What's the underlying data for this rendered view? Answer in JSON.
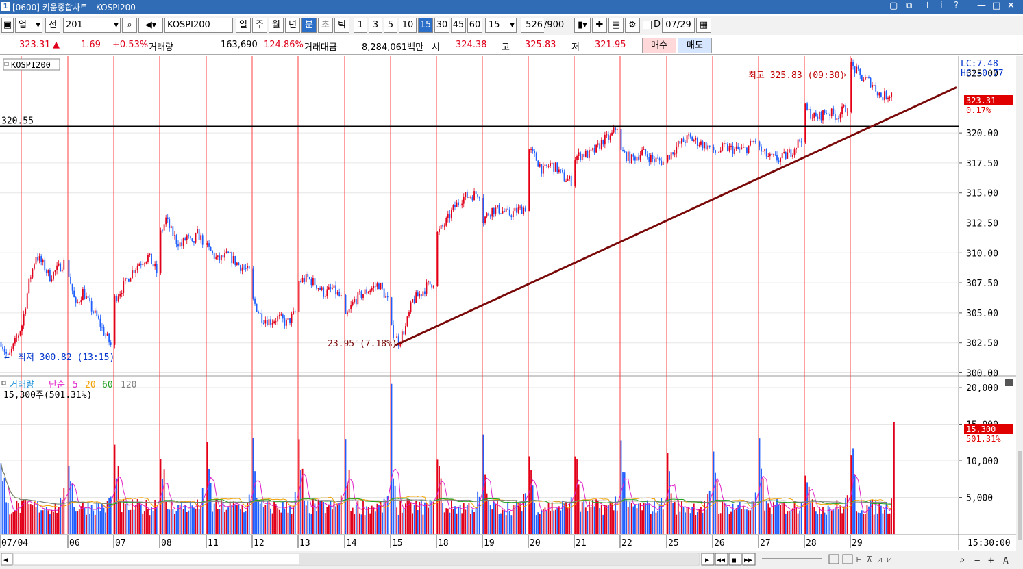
{
  "window": {
    "title": "[0600] 키움종합차트 - KOSPI200",
    "icon_label": "1"
  },
  "toolbar": {
    "market": "업",
    "prev": "전",
    "code": "201",
    "symbol": "KOSPI200",
    "periods": [
      "일",
      "주",
      "월",
      "년",
      "분",
      "초",
      "틱"
    ],
    "selected_period": "분",
    "intervals": [
      "1",
      "3",
      "5",
      "10",
      "15",
      "30",
      "45",
      "60"
    ],
    "selected_interval": "15",
    "interval_value": "15",
    "count": "526",
    "count_total": "/900",
    "date_checkbox_label": "D",
    "date": "07/29"
  },
  "quote": {
    "price": "323.31",
    "direction": "▲",
    "change": "1.69",
    "change_pct": "+0.53%",
    "volume_label": "거래량",
    "volume": "163,690",
    "volume_pct": "124.86%",
    "value_label": "거래대금",
    "value": "8,284,061백만",
    "open_label": "시",
    "open": "324.38",
    "high_label": "고",
    "high": "325.83",
    "low_label": "저",
    "low": "321.95",
    "buy_label": "매수",
    "sell_label": "매도"
  },
  "price_panel": {
    "legend": "KOSPI200",
    "hline_label": "320.55",
    "high_annotation": "최고 325.83 (09:30)",
    "low_annotation": "최저 300.82 (13:15)",
    "trend_annotation": "23.95°(7.18%)",
    "lc": "LC:7.48",
    "hc": "HC:-0.77",
    "current_price_tag": "323.31",
    "current_pct_tag": "0.17%"
  },
  "volume_panel": {
    "legend_title": "거래량",
    "legend_type": "단순",
    "legend_periods": [
      "5",
      "20",
      "60",
      "120"
    ],
    "current_value": "15,300주(501.31%)",
    "tag_value": "15,300",
    "tag_pct": "501.31%"
  },
  "colors": {
    "up": "#e0001b",
    "down": "#1f5fff",
    "trendline": "#7a0a0a",
    "ma5": "#e020c8",
    "ma20": "#f0a000",
    "ma60": "#20a020",
    "ma120": "#808080",
    "divider": "#ff4040"
  },
  "chart_data": {
    "type": "candlestick",
    "x_axis_labels": [
      "07/04",
      "06",
      "07",
      "08",
      "11",
      "12",
      "13",
      "14",
      "15",
      "18",
      "19",
      "20",
      "21",
      "22",
      "25",
      "26",
      "27",
      "28",
      "29"
    ],
    "time_label": "15:30:00",
    "price_ticks": [
      "325.00",
      "320.00",
      "317.50",
      "315.00",
      "312.50",
      "310.00",
      "307.50",
      "305.00",
      "302.50",
      "300.00"
    ],
    "price_range": [
      299.8,
      326.4
    ],
    "volume_ticks": [
      "20,000",
      "15,000",
      "10,000",
      "5,000"
    ],
    "volume_range": [
      0,
      21500
    ],
    "horizontal_line": 320.55,
    "trendline": {
      "from": {
        "day": "15",
        "price": 302.3
      },
      "to_price": 323.8
    },
    "daily_path": [
      {
        "day": "07/04",
        "prices": [
          302.6,
          301.2,
          302.5,
          304.0,
          307.5,
          309.8,
          309.0,
          308.0,
          308.6,
          309.2
        ]
      },
      {
        "day": "06",
        "prices": [
          308.2,
          305.5,
          306.8,
          305.6,
          304.6,
          303.4,
          302.3
        ]
      },
      {
        "day": "07",
        "prices": [
          306.2,
          307.2,
          308.4,
          309.2,
          309.7,
          308.4
        ]
      },
      {
        "day": "08",
        "prices": [
          311.6,
          312.8,
          311.8,
          311.0,
          310.6,
          311.4,
          310.6,
          311.6,
          311.0
        ]
      },
      {
        "day": "11",
        "prices": [
          310.4,
          309.4,
          309.8,
          309.0,
          308.4
        ]
      },
      {
        "day": "12",
        "prices": [
          306.0,
          304.6,
          304.3,
          304.6,
          304.1,
          305.0
        ]
      },
      {
        "day": "13",
        "prices": [
          307.6,
          307.9,
          307.4,
          306.6,
          307.0,
          306.2
        ]
      },
      {
        "day": "14",
        "prices": [
          304.5,
          306.0,
          306.6,
          307.0,
          307.4,
          306.0
        ]
      },
      {
        "day": "15",
        "prices": [
          303.6,
          302.6,
          303.8,
          306.0,
          306.5,
          307.2,
          307.6
        ]
      },
      {
        "day": "18",
        "prices": [
          311.6,
          312.5,
          313.8,
          314.6,
          314.8,
          315.0
        ]
      },
      {
        "day": "19",
        "prices": [
          312.8,
          313.6,
          313.6,
          313.2,
          313.5,
          313.8
        ]
      },
      {
        "day": "20",
        "prices": [
          318.6,
          317.8,
          316.8,
          317.4,
          317.0,
          316.2,
          316.0
        ]
      },
      {
        "day": "21",
        "prices": [
          318.0,
          318.2,
          318.2,
          318.6,
          319.4,
          319.6,
          320.6
        ]
      },
      {
        "day": "22",
        "prices": [
          318.4,
          317.8,
          318.4,
          317.8,
          317.6
        ]
      },
      {
        "day": "25",
        "prices": [
          318.0,
          319.0,
          319.6,
          319.2,
          318.8
        ]
      },
      {
        "day": "26",
        "prices": [
          318.2,
          318.8,
          318.6,
          318.6,
          319.4
        ]
      },
      {
        "day": "27",
        "prices": [
          318.6,
          317.9,
          317.8,
          318.4,
          319.6
        ]
      },
      {
        "day": "28",
        "prices": [
          322.0,
          321.2,
          321.8,
          321.4,
          322.2
        ]
      },
      {
        "day": "29",
        "prices": [
          325.6,
          324.6,
          324.2,
          323.0,
          323.3
        ]
      }
    ]
  }
}
